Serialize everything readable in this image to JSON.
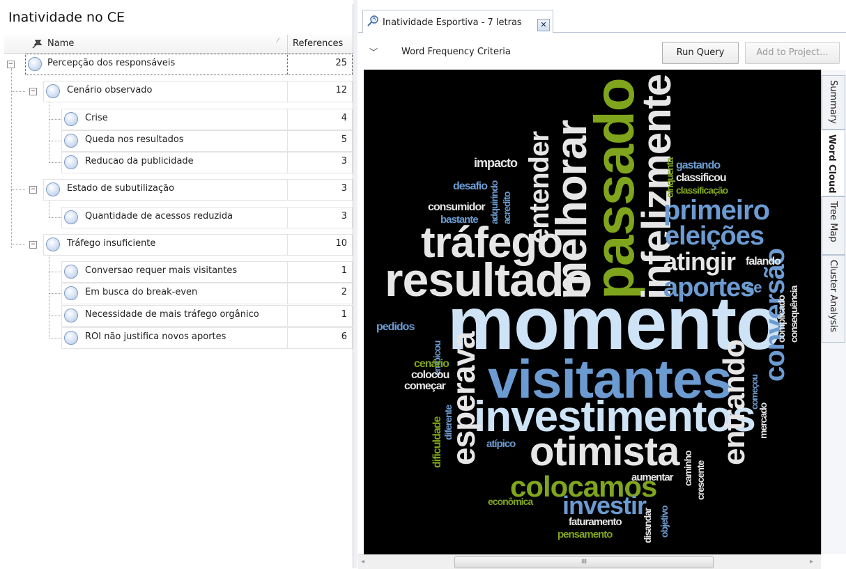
{
  "left_panel": {
    "title": "Inatividade no CE",
    "columns": {
      "name": "Name",
      "references": "References"
    },
    "nodes": [
      {
        "label": "Percepção dos responsáveis",
        "refs": "25"
      },
      {
        "label": "Cenário observado",
        "refs": "12"
      },
      {
        "label": "Crise",
        "refs": "4"
      },
      {
        "label": "Queda nos resultados",
        "refs": "5"
      },
      {
        "label": "Reducao da publicidade",
        "refs": "3"
      },
      {
        "label": "Estado de subutilização",
        "refs": "3"
      },
      {
        "label": "Quantidade de acessos reduzida",
        "refs": "3"
      },
      {
        "label": "Tráfego insuficiente",
        "refs": "10"
      },
      {
        "label": "Conversao requer mais visitantes",
        "refs": "1"
      },
      {
        "label": "Em busca do break-even",
        "refs": "2"
      },
      {
        "label": "Necessidade de mais tráfego orgânico",
        "refs": "1"
      },
      {
        "label": "ROI não justifica novos aportes",
        "refs": "6"
      }
    ]
  },
  "right_panel": {
    "tab_title": "Inatividade Esportiva - 7 letras",
    "criteria_label": "Word Frequency Criteria",
    "run_button": "Run Query",
    "add_button": "Add to Project...",
    "side_tabs": [
      "Summary",
      "Word Cloud",
      "Tree Map",
      "Cluster Analysis"
    ],
    "active_side_tab": "Word Cloud",
    "scroll_thumb": "III"
  },
  "colors": {
    "cloud_bg": "#000000",
    "white": "#e6e6e6",
    "light_blue": "#cfe3f7",
    "steel_blue": "#6b9bd1",
    "olive": "#7fa51c"
  },
  "word_cloud": [
    {
      "text": "momento"
    },
    {
      "text": "visitantes"
    },
    {
      "text": "investimentos"
    },
    {
      "text": "resultado"
    },
    {
      "text": "passado"
    },
    {
      "text": "melhorar"
    },
    {
      "text": "infelizmente"
    },
    {
      "text": "tráfego"
    },
    {
      "text": "otimista"
    },
    {
      "text": "entender"
    },
    {
      "text": "primeiro"
    },
    {
      "text": "eleições"
    },
    {
      "text": "atingir"
    },
    {
      "text": "aportes"
    },
    {
      "text": "esperava"
    },
    {
      "text": "entrando"
    },
    {
      "text": "conversão"
    },
    {
      "text": "colocamos"
    },
    {
      "text": "investir"
    },
    {
      "text": "impacto"
    },
    {
      "text": "gastando"
    },
    {
      "text": "classificou"
    },
    {
      "text": "classificação"
    },
    {
      "text": "cinquenta"
    },
    {
      "text": "desafio"
    },
    {
      "text": "consumidor"
    },
    {
      "text": "bastante"
    },
    {
      "text": "adquirindo"
    },
    {
      "text": "acredito"
    },
    {
      "text": "falando"
    },
    {
      "text": "consequência"
    },
    {
      "text": "complicado"
    },
    {
      "text": "pedidos"
    },
    {
      "text": "embicou"
    },
    {
      "text": "cenário"
    },
    {
      "text": "colocou"
    },
    {
      "text": "começar"
    },
    {
      "text": "dificuldade"
    },
    {
      "text": "diferente"
    },
    {
      "text": "atípico"
    },
    {
      "text": "começou"
    },
    {
      "text": "mercado"
    },
    {
      "text": "caminho"
    },
    {
      "text": "crescente"
    },
    {
      "text": "aumentar"
    },
    {
      "text": "econômica"
    },
    {
      "text": "objetivo"
    },
    {
      "text": "disandar"
    },
    {
      "text": "faturamento"
    },
    {
      "text": "pensamento"
    },
    {
      "text": "se"
    }
  ]
}
